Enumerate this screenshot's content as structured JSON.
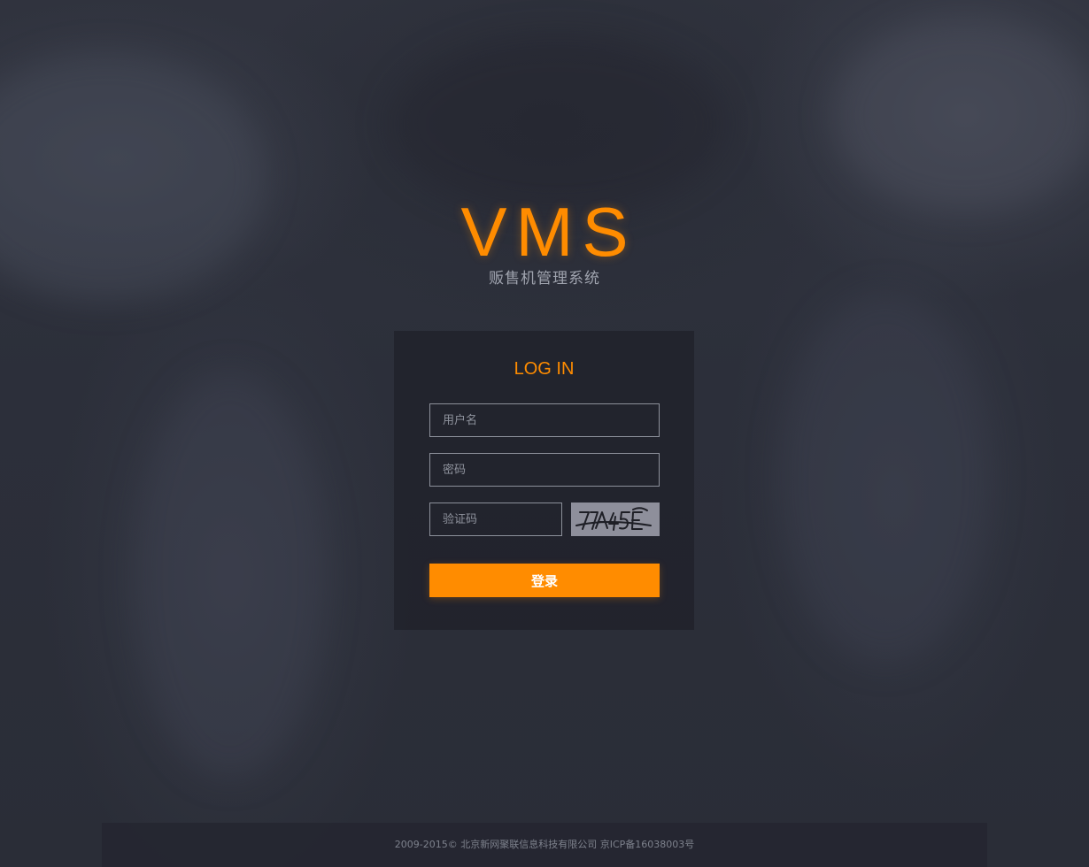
{
  "brand": {
    "title": "VMS",
    "subtitle": "贩售机管理系统"
  },
  "login": {
    "heading": "LOG IN",
    "username": {
      "value": "",
      "placeholder": "用户名"
    },
    "password": {
      "value": "",
      "placeholder": "密码"
    },
    "captcha": {
      "value": "",
      "placeholder": "验证码",
      "image_text": "7A45E"
    },
    "submit_label": "登录"
  },
  "footer": {
    "copyright": "2009-2015© 北京新网聚联信息科技有限公司 京ICP备16038003号"
  },
  "colors": {
    "accent": "#ff8c00",
    "background": "#2b2e38",
    "panel": "#1e2028"
  }
}
